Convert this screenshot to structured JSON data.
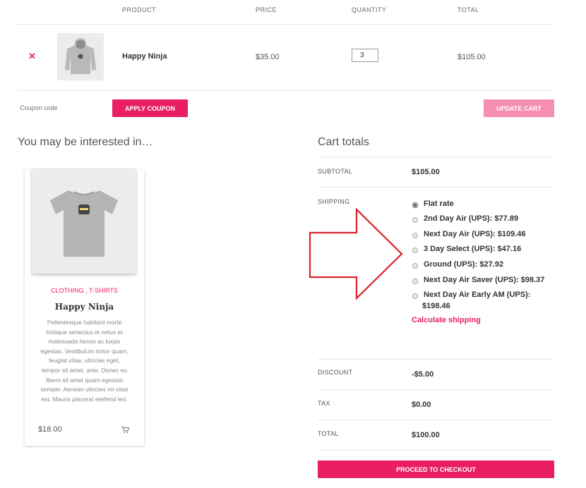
{
  "cart": {
    "headers": {
      "product": "PRODUCT",
      "price": "PRICE",
      "quantity": "QUANTITY",
      "total": "TOTAL"
    },
    "item": {
      "name": "Happy Ninja",
      "price": "$35.00",
      "quantity": "3",
      "total": "$105.00",
      "remove_icon": "close-icon"
    },
    "coupon_placeholder": "Coupon code",
    "apply_coupon_label": "APPLY COUPON",
    "update_cart_label": "UPDATE CART"
  },
  "related": {
    "heading": "You may be interested in…",
    "product": {
      "categories": "CLOTHING , T-SHIRTS",
      "name": "Happy Ninja",
      "description": "Pellentesque habitant morbi tristique senectus et netus et malesuada fames ac turpis egestas. Vestibulum tortor quam, feugiat vitae, ultricies eget, tempor sit amet, ante. Donec eu libero sit amet quam egestas semper. Aenean ultricies mi vitae est. Mauris placerat eleifend leo.",
      "price": "$18.00",
      "cart_icon": "cart-icon"
    }
  },
  "totals": {
    "heading": "Cart totals",
    "subtotal_label": "SUBTOTAL",
    "subtotal_value": "$105.00",
    "shipping_label": "SHIPPING",
    "shipping_options": [
      {
        "label": "Flat rate",
        "selected": true
      },
      {
        "label": "2nd Day Air (UPS): $77.89",
        "selected": false
      },
      {
        "label": "Next Day Air (UPS): $109.46",
        "selected": false
      },
      {
        "label": "3 Day Select (UPS): $47.16",
        "selected": false
      },
      {
        "label": "Ground (UPS): $27.92",
        "selected": false
      },
      {
        "label": "Next Day Air Saver (UPS): $98.37",
        "selected": false
      },
      {
        "label": "Next Day Air Early AM (UPS):",
        "label_line2": "$198.46",
        "selected": false
      }
    ],
    "calculate_shipping": "Calculate shipping",
    "discount_label": "DISCOUNT",
    "discount_value": "-$5.00",
    "tax_label": "TAX",
    "tax_value": "$0.00",
    "total_label": "TOTAL",
    "total_value": "$100.00",
    "checkout_label": "PROCEED TO CHECKOUT"
  },
  "colors": {
    "accent": "#e91e63",
    "accent_light": "#f48fb1",
    "arrow": "#d9232d"
  }
}
